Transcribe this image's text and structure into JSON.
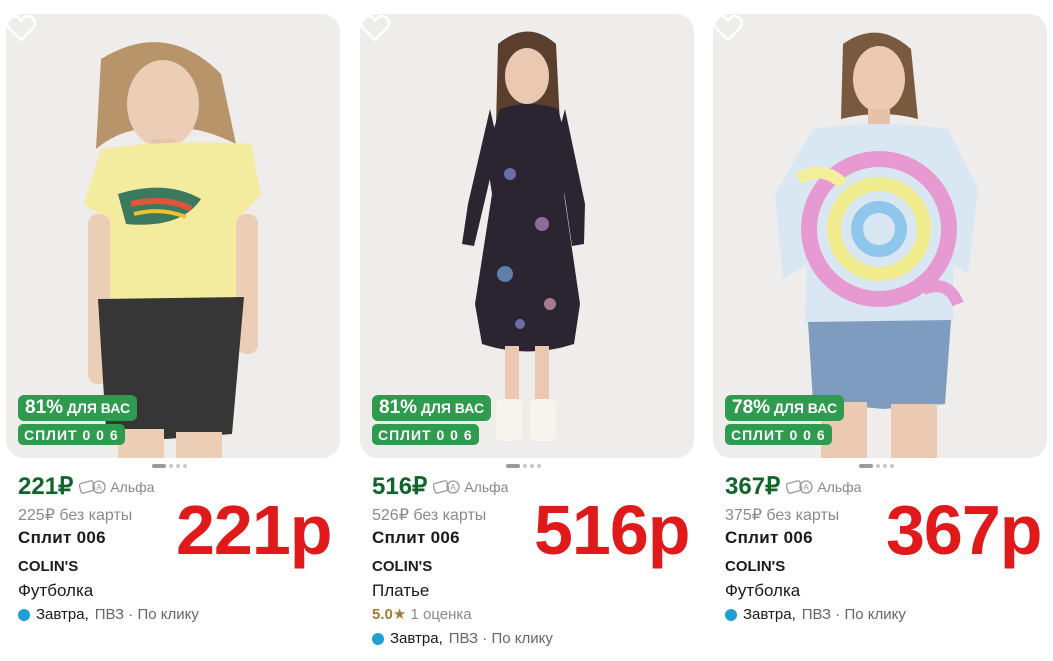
{
  "cards": [
    {
      "discount_pct": "81%",
      "discount_label": "ДЛЯ ВАС",
      "split_badge": "СПЛИТ 0 0 6",
      "price": "221",
      "currency": "₽",
      "bank": "Альфа",
      "old_price": "225₽",
      "old_price_note": "без карты",
      "split_text": "Сплит 006",
      "brand": "COLIN'S",
      "product_type": "Футболка",
      "delivery_day": "Завтра,",
      "delivery_rest": "ПВЗ · По клику",
      "overlay_price": "221р",
      "image": "woman-yellow-crop-tee-denim-shorts"
    },
    {
      "discount_pct": "81%",
      "discount_label": "ДЛЯ ВАС",
      "split_badge": "СПЛИТ 0 0 6",
      "price": "516",
      "currency": "₽",
      "bank": "Альфа",
      "old_price": "526₽",
      "old_price_note": "без карты",
      "split_text": "Сплит 006",
      "brand": "COLIN'S",
      "product_type": "Платье",
      "rating_value": "5.0",
      "rating_star": "★",
      "rating_count": "1 оценка",
      "delivery_day": "Завтра,",
      "delivery_rest": "ПВЗ · По клику",
      "overlay_price": "516р",
      "image": "woman-black-floral-midi-dress"
    },
    {
      "discount_pct": "78%",
      "discount_label": "ДЛЯ ВАС",
      "split_badge": "СПЛИТ 0 0 6",
      "price": "367",
      "currency": "₽",
      "bank": "Альфа",
      "old_price": "375₽",
      "old_price_note": "без карты",
      "split_text": "Сплит 006",
      "brand": "COLIN'S",
      "product_type": "Футболка",
      "delivery_day": "Завтра,",
      "delivery_rest": "ПВЗ · По клику",
      "overlay_price": "367р",
      "image": "woman-tie-dye-tee-denim-shorts"
    }
  ],
  "colors": {
    "badge_green": "#2e9b4e",
    "price_green": "#10652b",
    "overlay_red": "#e0191b",
    "delivery_dot": "#1e9fd8",
    "rating_gold": "#a07f2e"
  }
}
